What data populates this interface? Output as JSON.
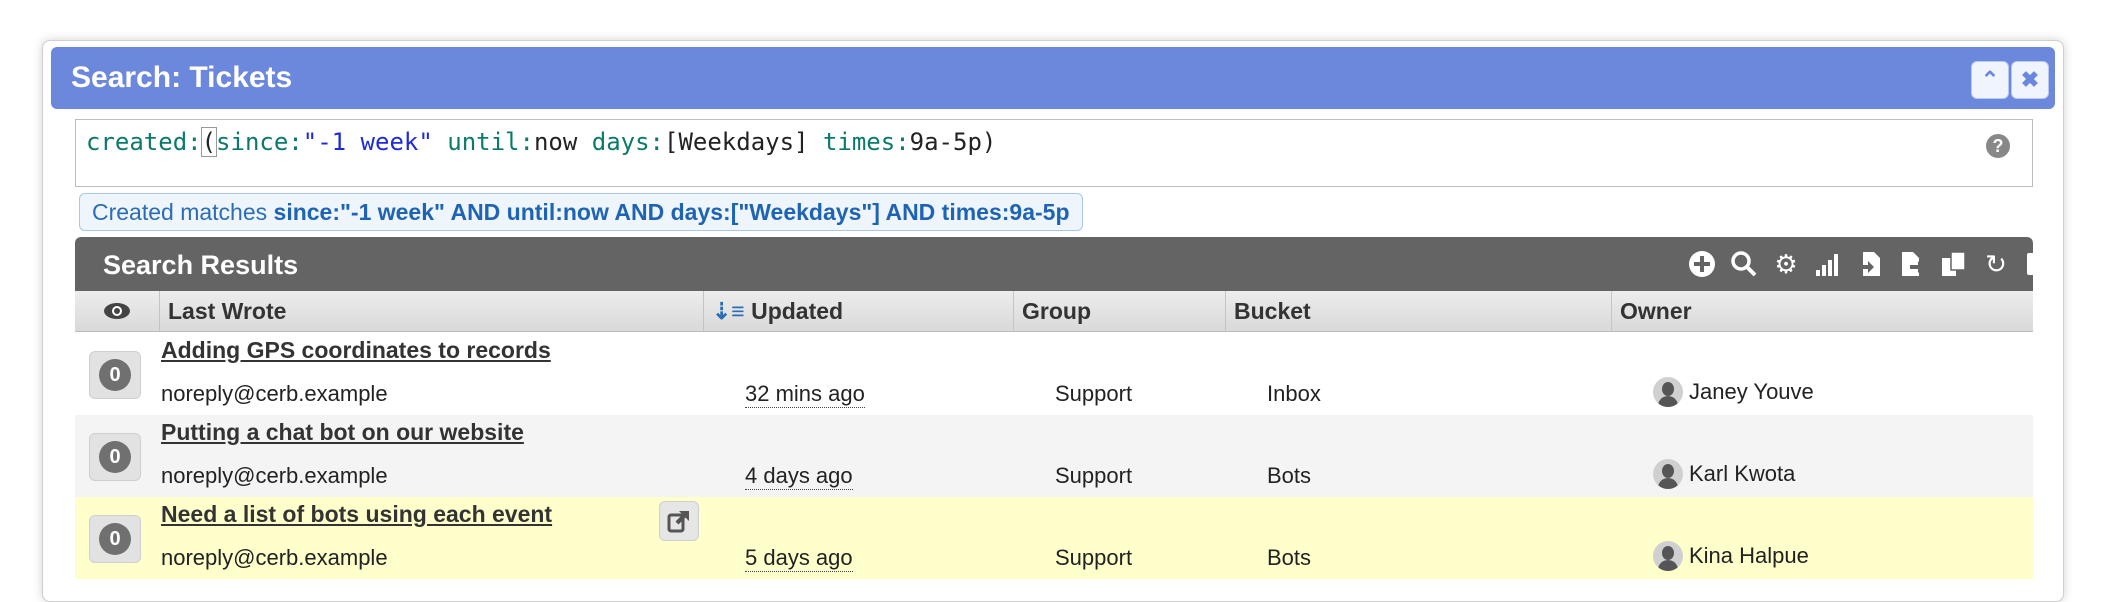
{
  "dialog": {
    "title": "Search: Tickets"
  },
  "query": {
    "parts": [
      {
        "t": "created:",
        "c": "key"
      },
      {
        "t": "(",
        "c": "br"
      },
      {
        "t": "since:",
        "c": "key"
      },
      {
        "t": "\"-1 week\"",
        "c": "str"
      },
      {
        "t": " ",
        "c": ""
      },
      {
        "t": "until:",
        "c": "key"
      },
      {
        "t": "now ",
        "c": ""
      },
      {
        "t": "days:",
        "c": "key"
      },
      {
        "t": "[Weekdays] ",
        "c": ""
      },
      {
        "t": "times:",
        "c": "key"
      },
      {
        "t": "9a-5p)",
        "c": ""
      }
    ]
  },
  "summary": {
    "prefix": "Created matches ",
    "criteria": "since:\"-1 week\" AND until:now AND days:[\"Weekdays\"] AND times:9a-5p"
  },
  "results": {
    "title": "Search Results",
    "icons": [
      "add-icon",
      "search-icon",
      "settings-icon",
      "chart-icon",
      "import-icon",
      "export-icon",
      "copy-icon",
      "refresh-icon",
      "select-all-icon"
    ]
  },
  "columns": {
    "last_wrote": "Last Wrote",
    "updated": "Updated",
    "group": "Group",
    "bucket": "Bucket",
    "owner": "Owner"
  },
  "rows": [
    {
      "count": "0",
      "subject": "Adding GPS coordinates to records",
      "last_wrote": "noreply@cerb.example",
      "updated": "32 mins ago",
      "group": "Support",
      "bucket": "Inbox",
      "owner": "Janey Youve"
    },
    {
      "count": "0",
      "subject": "Putting a chat bot on our website",
      "last_wrote": "noreply@cerb.example",
      "updated": "4 days ago",
      "group": "Support",
      "bucket": "Bots",
      "owner": "Karl Kwota"
    },
    {
      "count": "0",
      "subject": "Need a list of bots using each event",
      "last_wrote": "noreply@cerb.example",
      "updated": "5 days ago",
      "group": "Support",
      "bucket": "Bots",
      "owner": "Kina Halpue"
    }
  ]
}
